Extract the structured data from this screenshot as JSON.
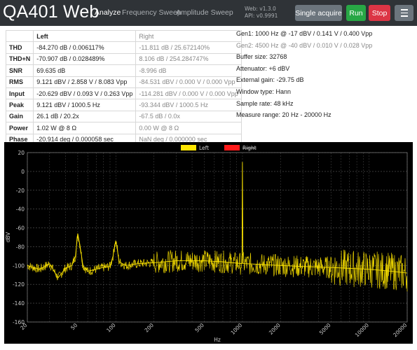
{
  "app": {
    "title": "QA401 Web",
    "nav": [
      "Analyze",
      "Frequency Sweep",
      "Amplitude Sweep"
    ],
    "active_nav": "Analyze",
    "version_web": "Web: v1.3.0",
    "version_api": "API: v0.9991"
  },
  "buttons": {
    "single": "Single acquire",
    "run": "Run",
    "stop": "Stop",
    "menu_icon": "hamburger-icon"
  },
  "colors": {
    "navbar": "#2f3337",
    "run": "#28a745",
    "stop": "#dc3545",
    "secondary": "#6c757d",
    "left_trace": "#ffe600",
    "right_trace": "#ff1a1a"
  },
  "table": {
    "headers": [
      "",
      "Left",
      "Right"
    ],
    "rows": [
      {
        "label": "THD",
        "left": "-84.270 dB / 0.006117%",
        "right": "-11.811 dB / 25.672140%"
      },
      {
        "label": "THD+N",
        "left": "-70.907 dB / 0.028489%",
        "right": "8.106 dB / 254.284747%"
      },
      {
        "label": "SNR",
        "left": "69.635 dB",
        "right": "-8.996 dB"
      },
      {
        "label": "RMS",
        "left": "9.121 dBV / 2.858 V / 8.083 Vpp",
        "right": "-84.531 dBV / 0.000 V / 0.000 Vpp"
      },
      {
        "label": "Input",
        "left": "-20.629 dBV / 0.093 V / 0.263 Vpp",
        "right": "-114.281 dBV / 0.000 V / 0.000 Vpp"
      },
      {
        "label": "Peak",
        "left": "9.121 dBV / 1000.5 Hz",
        "right": "-93.344 dBV / 1000.5 Hz"
      },
      {
        "label": "Gain",
        "left": "26.1 dB / 20.2x",
        "right": "-67.5 dB / 0.0x"
      },
      {
        "label": "Power",
        "left": "1.02 W @ 8 Ω",
        "right": "0.00 W @ 8 Ω"
      },
      {
        "label": "Phase",
        "left": "-20.914 deg / 0.000058 sec",
        "right": "NaN deg / 0.000000 sec"
      }
    ]
  },
  "info": [
    {
      "text": "Gen1: 1000 Hz @ -17 dBV / 0.141 V / 0.400 Vpp",
      "dim": false
    },
    {
      "text": "Gen2: 4500 Hz @ -40 dBV / 0.010 V / 0.028 Vpp",
      "dim": true
    },
    {
      "text": "Buffer size: 32768",
      "dim": false
    },
    {
      "text": "Attenuator: +6 dBV",
      "dim": false
    },
    {
      "text": "External gain: -29.75 dB",
      "dim": false
    },
    {
      "text": "Window type: Hann",
      "dim": false
    },
    {
      "text": "Sample rate: 48 kHz",
      "dim": false
    },
    {
      "text": "Measure range: 20 Hz - 20000 Hz",
      "dim": false
    }
  ],
  "chart_data": {
    "type": "line",
    "xlabel": "Hz",
    "ylabel": "dBV",
    "x_scale": "log",
    "xlim": [
      20,
      20000
    ],
    "ylim": [
      -160,
      20
    ],
    "x_ticks": [
      20,
      50,
      100,
      200,
      500,
      1000,
      2000,
      5000,
      10000,
      20000
    ],
    "y_ticks": [
      20,
      0,
      -20,
      -40,
      -60,
      -80,
      -100,
      -120,
      -140,
      -160
    ],
    "grid": true,
    "legend_position": "top-center",
    "series": [
      {
        "name": "Left",
        "color": "#ffe600",
        "hidden": false,
        "points": [
          [
            20,
            -100
          ],
          [
            25,
            -104
          ],
          [
            30,
            -98
          ],
          [
            35,
            -113
          ],
          [
            40,
            -103
          ],
          [
            45,
            -100
          ],
          [
            48,
            -90
          ],
          [
            50,
            -66
          ],
          [
            52,
            -78
          ],
          [
            55,
            -100
          ],
          [
            60,
            -106
          ],
          [
            70,
            -104
          ],
          [
            80,
            -102
          ],
          [
            90,
            -101
          ],
          [
            95,
            -90
          ],
          [
            98,
            -78
          ],
          [
            100,
            -74
          ],
          [
            102,
            -80
          ],
          [
            106,
            -96
          ],
          [
            120,
            -100
          ],
          [
            150,
            -98
          ],
          [
            200,
            -97
          ],
          [
            300,
            -95
          ],
          [
            500,
            -95
          ],
          [
            700,
            -96
          ],
          [
            990,
            -98
          ],
          [
            1000,
            10
          ],
          [
            1010,
            -98
          ],
          [
            1500,
            -99
          ],
          [
            2000,
            -100
          ],
          [
            3000,
            -101
          ],
          [
            5000,
            -102
          ],
          [
            7000,
            -103
          ],
          [
            10000,
            -104
          ],
          [
            15000,
            -106
          ],
          [
            20000,
            -108
          ]
        ]
      },
      {
        "name": "Right",
        "color": "#ff1a1a",
        "hidden": true,
        "points": []
      }
    ]
  }
}
